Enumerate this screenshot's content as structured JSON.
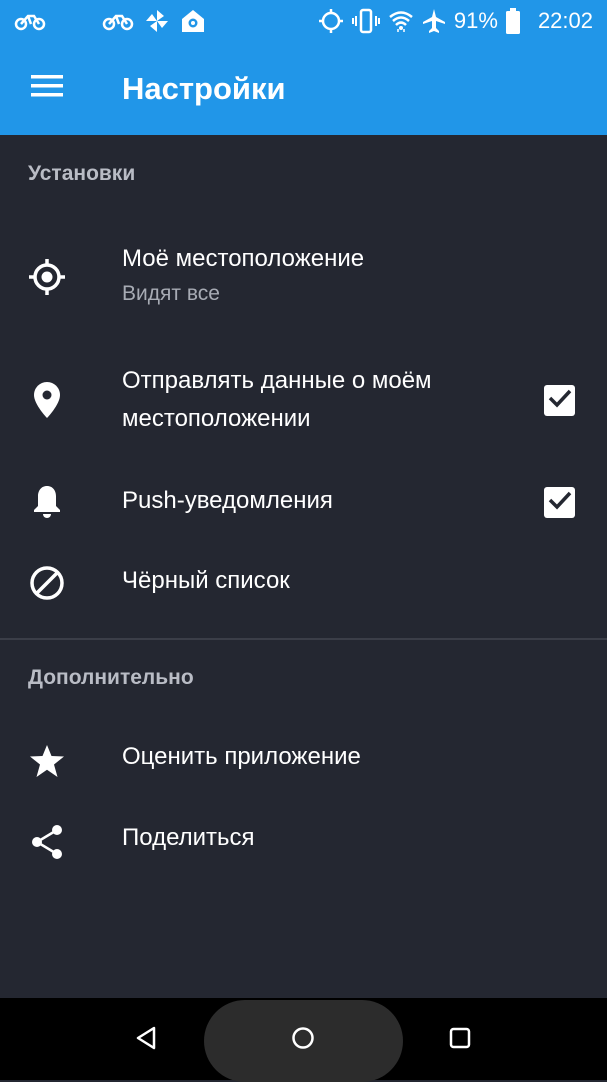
{
  "status_bar": {
    "battery_percent": "91%",
    "time": "22:02",
    "left_icons": [
      "bike-icon",
      "bike-icon",
      "pinwheel-icon",
      "home-shield-icon"
    ],
    "right_icons": [
      "location-target-icon",
      "vibrate-icon",
      "wifi-icon",
      "airplane-icon",
      "battery-icon"
    ]
  },
  "app_bar": {
    "title": "Настройки",
    "color": "#2196e8"
  },
  "sections": [
    {
      "header": "Установки",
      "items": [
        {
          "icon": "crosshair-icon",
          "title": "Моё местоположение",
          "subtitle": "Видят все"
        },
        {
          "icon": "map-pin-icon",
          "title_line1": "Отправлять данные о моём",
          "title_line2": "местоположении",
          "checked": true
        },
        {
          "icon": "bell-icon",
          "title": "Push-уведомления",
          "checked": true
        },
        {
          "icon": "block-icon",
          "title": "Чёрный список"
        }
      ]
    },
    {
      "header": "Дополнительно",
      "items": [
        {
          "icon": "star-icon",
          "title": "Оценить приложение"
        },
        {
          "icon": "share-icon",
          "title": "Поделиться"
        }
      ]
    }
  ],
  "nav_bar": {
    "buttons": [
      "back-icon",
      "home-icon",
      "recents-icon"
    ]
  }
}
